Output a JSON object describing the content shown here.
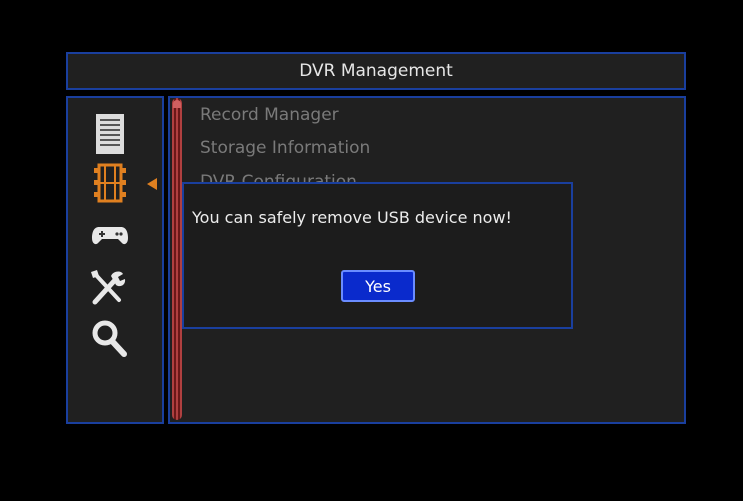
{
  "header": {
    "title": "DVR Management"
  },
  "sidebar": {
    "items": [
      {
        "icon": "document-icon",
        "selected": false
      },
      {
        "icon": "film-icon",
        "selected": true
      },
      {
        "icon": "gamepad-icon",
        "selected": false
      },
      {
        "icon": "tools-icon",
        "selected": false
      },
      {
        "icon": "search-icon",
        "selected": false
      }
    ],
    "accent_color": "#e08020"
  },
  "menu": {
    "items": [
      {
        "label": "Record Manager"
      },
      {
        "label": "Storage Information"
      },
      {
        "label": "DVR Configuration"
      }
    ]
  },
  "dialog": {
    "message": "You can safely remove USB device now!",
    "yes_label": "Yes"
  },
  "colors": {
    "border": "#1a3f9e",
    "button": "#0a2acc",
    "panel": "#202020"
  }
}
